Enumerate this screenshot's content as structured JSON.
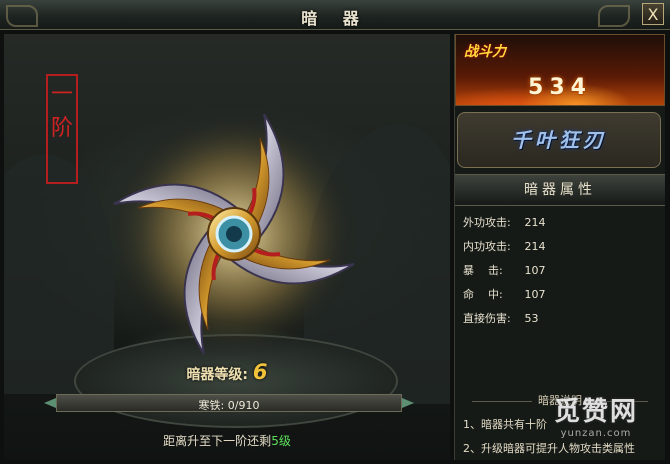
{
  "window": {
    "title": "暗 器",
    "close_label": "X"
  },
  "left_panel": {
    "rank_seal": [
      "一",
      "阶"
    ],
    "level_label": "暗器等级:",
    "level_value": "6",
    "progress": {
      "text": "寒铁: 0/910",
      "fraction": 0.0
    },
    "next_text_prefix": "距离升至下一阶还剩",
    "next_text_value": "5级"
  },
  "right_panel": {
    "power_label": "战斗力",
    "power_value": "534",
    "weapon_name": "千叶狂刃",
    "attr_header": "暗器属性",
    "stats": [
      {
        "label": "外功攻击:",
        "value": "214"
      },
      {
        "label": "内功攻击:",
        "value": "214"
      },
      {
        "label": "暴    击:",
        "value": "107"
      },
      {
        "label": "命    中:",
        "value": "107"
      },
      {
        "label": "直接伤害:",
        "value": "53"
      }
    ],
    "desc_title": "暗器说明",
    "desc_items": [
      "1、暗器共有十阶",
      "2、升级暗器可提升人物攻击类属性"
    ]
  },
  "watermark": {
    "main": "觅赞网",
    "sub": "yunzan.com"
  },
  "colors": {
    "accent_gold": "#f2c23a",
    "seal_red": "#cf2222",
    "next_level_green": "#5ce05c",
    "weapon_name_blue": "#9fc0ea"
  }
}
